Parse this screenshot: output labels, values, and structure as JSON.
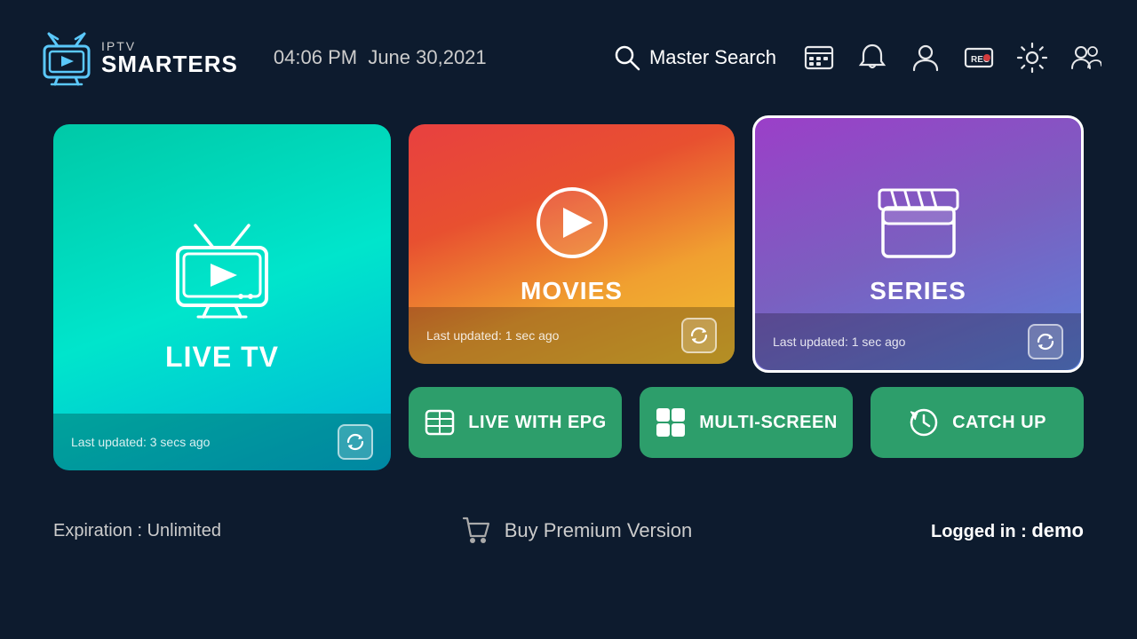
{
  "header": {
    "logo_iptv": "IPTV",
    "logo_smarters": "SMARTERS",
    "time": "04:06 PM",
    "date": "June 30,2021",
    "search_label": "Master Search"
  },
  "cards": {
    "live_tv": {
      "title": "LIVE TV",
      "last_updated": "Last updated: 3 secs ago"
    },
    "movies": {
      "title": "MOVIES",
      "last_updated": "Last updated: 1 sec ago"
    },
    "series": {
      "title": "SERIES",
      "last_updated": "Last updated: 1 sec ago"
    }
  },
  "buttons": {
    "live_epg": "LIVE WITH EPG",
    "multi_screen": "MULTI-SCREEN",
    "catch_up": "CATCH UP"
  },
  "footer": {
    "expiration": "Expiration : Unlimited",
    "buy_premium": "Buy Premium Version",
    "logged_in_label": "Logged in : ",
    "logged_in_user": "demo"
  }
}
